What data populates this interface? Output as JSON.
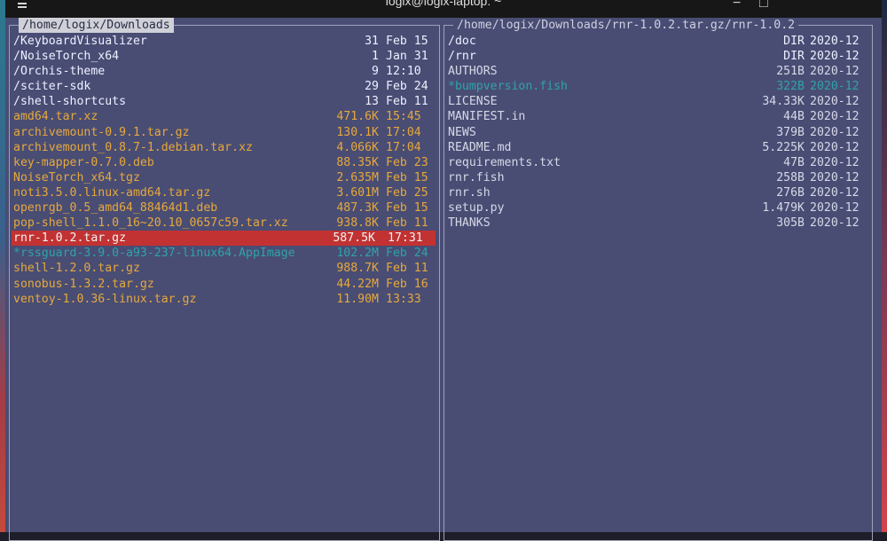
{
  "window": {
    "title": "logix@logix-laptop: ~",
    "icon": "menu-icon"
  },
  "left_panel": {
    "path": "/home/logix/Downloads",
    "items": [
      {
        "name": "/KeyboardVisualizer",
        "size": "31",
        "date": "Feb 15",
        "kind": "dir"
      },
      {
        "name": "/NoiseTorch_x64",
        "size": "1",
        "date": "Jan 31",
        "kind": "dir"
      },
      {
        "name": "/Orchis-theme",
        "size": "9",
        "date": "12:10",
        "kind": "dir"
      },
      {
        "name": "/sciter-sdk",
        "size": "29",
        "date": "Feb 24",
        "kind": "dir"
      },
      {
        "name": "/shell-shortcuts",
        "size": "13",
        "date": "Feb 11",
        "kind": "dir"
      },
      {
        "name": " amd64.tar.xz",
        "size": "471.6K",
        "date": "15:45",
        "kind": "file"
      },
      {
        "name": " archivemount-0.9.1.tar.gz",
        "size": "130.1K",
        "date": "17:04",
        "kind": "file"
      },
      {
        "name": " archivemount_0.8.7-1.debian.tar.xz",
        "size": "4.066K",
        "date": "17:04",
        "kind": "file"
      },
      {
        "name": " key-mapper-0.7.0.deb",
        "size": "88.35K",
        "date": "Feb 23",
        "kind": "file"
      },
      {
        "name": " NoiseTorch_x64.tgz",
        "size": "2.635M",
        "date": "Feb 15",
        "kind": "file"
      },
      {
        "name": " noti3.5.0.linux-amd64.tar.gz",
        "size": "3.601M",
        "date": "Feb 25",
        "kind": "file"
      },
      {
        "name": " openrgb_0.5_amd64_88464d1.deb",
        "size": "487.3K",
        "date": "Feb 15",
        "kind": "file"
      },
      {
        "name": " pop-shell_1.1.0_16~20.10_0657c59.tar.xz",
        "size": "938.8K",
        "date": "Feb 11",
        "kind": "file"
      },
      {
        "name": " rnr-1.0.2.tar.gz",
        "size": "587.5K",
        "date": "17:31",
        "kind": "selected"
      },
      {
        "name": "*rssguard-3.9.0-a93-237-linux64.AppImage",
        "size": "102.2M",
        "date": "Feb 24",
        "kind": "link"
      },
      {
        "name": " shell-1.2.0.tar.gz",
        "size": "988.7K",
        "date": "Feb 11",
        "kind": "file"
      },
      {
        "name": " sonobus-1.3.2.tar.gz",
        "size": "44.22M",
        "date": "Feb 16",
        "kind": "file"
      },
      {
        "name": " ventoy-1.0.36-linux.tar.gz",
        "size": "11.90M",
        "date": "13:33",
        "kind": "file"
      }
    ]
  },
  "right_panel": {
    "path": "/home/logix/Downloads/rnr-1.0.2.tar.gz/rnr-1.0.2",
    "items": [
      {
        "name": "/doc",
        "size": "DIR",
        "date": "2020-12",
        "kind": "dir"
      },
      {
        "name": "/rnr",
        "size": "DIR",
        "date": "2020-12",
        "kind": "dir"
      },
      {
        "name": " AUTHORS",
        "size": "251B",
        "date": "2020-12",
        "kind": "plain"
      },
      {
        "name": "*bumpversion.fish",
        "size": "322B",
        "date": "2020-12",
        "kind": "link"
      },
      {
        "name": " LICENSE",
        "size": "34.33K",
        "date": "2020-12",
        "kind": "plain"
      },
      {
        "name": " MANIFEST.in",
        "size": "44B",
        "date": "2020-12",
        "kind": "plain"
      },
      {
        "name": " NEWS",
        "size": "379B",
        "date": "2020-12",
        "kind": "plain"
      },
      {
        "name": " README.md",
        "size": "5.225K",
        "date": "2020-12",
        "kind": "plain"
      },
      {
        "name": " requirements.txt",
        "size": "47B",
        "date": "2020-12",
        "kind": "plain"
      },
      {
        "name": " rnr.fish",
        "size": "258B",
        "date": "2020-12",
        "kind": "plain"
      },
      {
        "name": " rnr.sh",
        "size": "276B",
        "date": "2020-12",
        "kind": "plain"
      },
      {
        "name": " setup.py",
        "size": "1.479K",
        "date": "2020-12",
        "kind": "plain"
      },
      {
        "name": " THANKS",
        "size": "305B",
        "date": "2020-12",
        "kind": "plain"
      }
    ]
  },
  "colors": {
    "background": "#494d74",
    "directory": "#eef0ff",
    "archive_file": "#e7a83b",
    "plain_file": "#d6d8e6",
    "executable": "#2fa3aa",
    "selection": "#c23232"
  }
}
